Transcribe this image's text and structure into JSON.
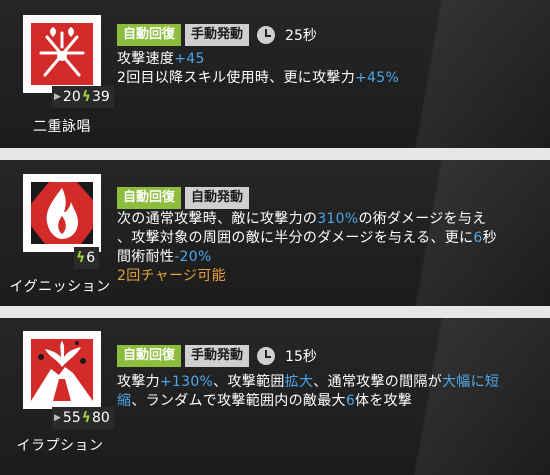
{
  "skills": [
    {
      "name": "二重詠唱",
      "icon": "double-chant-icon",
      "cost_a": "20",
      "cost_b": "39",
      "tags": [
        "自動回復",
        "手動発動"
      ],
      "cooldown": "25秒",
      "lines": [
        [
          {
            "t": "攻撃速度",
            "c": "w"
          },
          {
            "t": "+45",
            "c": "b"
          }
        ],
        [
          {
            "t": "2回目以降スキル使用時、更に攻撃力",
            "c": "w"
          },
          {
            "t": "+45%",
            "c": "b"
          }
        ]
      ]
    },
    {
      "name": "イグニッション",
      "icon": "fire-flame-icon",
      "cost_b": "6",
      "tags": [
        "自動回復",
        "自動発動"
      ],
      "lines": [
        [
          {
            "t": "次の通常攻撃時、敵に攻撃力の",
            "c": "w"
          },
          {
            "t": "310%",
            "c": "b"
          },
          {
            "t": "の術ダメージを与え",
            "c": "w"
          }
        ],
        [
          {
            "t": "、攻撃対象の周囲の敵に半分のダメージを与える、更に",
            "c": "w"
          },
          {
            "t": "6",
            "c": "b"
          },
          {
            "t": "秒",
            "c": "w"
          }
        ],
        [
          {
            "t": "間術耐性",
            "c": "w"
          },
          {
            "t": "-20%",
            "c": "b"
          }
        ],
        [
          {
            "t": "2回チャージ可能",
            "c": "o"
          }
        ]
      ]
    },
    {
      "name": "イラプション",
      "icon": "eruption-volcano-icon",
      "cost_a": "55",
      "cost_b": "80",
      "tags": [
        "自動回復",
        "手動発動"
      ],
      "cooldown": "15秒",
      "lines": [
        [
          {
            "t": "攻撃力",
            "c": "w"
          },
          {
            "t": "+130%",
            "c": "b"
          },
          {
            "t": "、攻撃範囲",
            "c": "w"
          },
          {
            "t": "拡大",
            "c": "b"
          },
          {
            "t": "、通常攻撃の間隔が",
            "c": "w"
          },
          {
            "t": "大幅に短",
            "c": "b"
          }
        ],
        [
          {
            "t": "縮",
            "c": "b"
          },
          {
            "t": "、ランダムで攻撃範囲内の敵最大",
            "c": "w"
          },
          {
            "t": "6",
            "c": "b"
          },
          {
            "t": "体を攻撃",
            "c": "w"
          }
        ]
      ]
    }
  ]
}
